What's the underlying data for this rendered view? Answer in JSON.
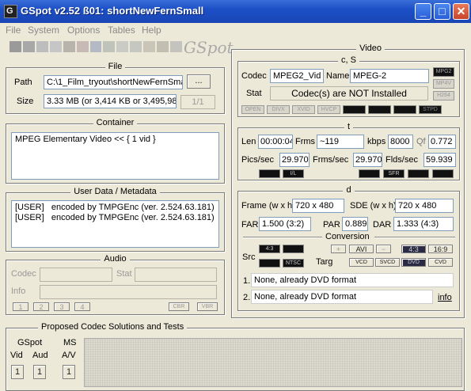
{
  "window": {
    "title": "GSpot v2.52 ß01: shortNewFernSmall",
    "minimize": "_",
    "maximize": "□",
    "close": "✕",
    "app_icon_glyph": "G"
  },
  "menu": [
    "File",
    "System",
    "Options",
    "Tables",
    "Help"
  ],
  "logo": "GSpot",
  "progress_colors": [
    "#9a9a9a",
    "#a8a8a8",
    "#bdbdbd",
    "#c6c6c6",
    "#b8b4ab",
    "#c7b9b5",
    "#b5b9c4",
    "#bfc3ba",
    "#cbcbc5",
    "#c5c8c0",
    "#c9c5b7",
    "#c2beb2",
    "#c5c3bd"
  ],
  "file": {
    "title": "File",
    "path_label": "Path",
    "path_value": "C:\\1_Film_tryout\\shortNewFernSma",
    "browse_label": "...",
    "size_label": "Size",
    "size_value": "3.33 MB (or 3,414 KB or 3,495,989 byt",
    "page_label": "1/1"
  },
  "container": {
    "title": "Container",
    "text": "MPEG Elementary Video << { 1 vid }"
  },
  "userdata": {
    "title": "User Data / Metadata",
    "lines": "[USER]   encoded by TMPGEnc (ver. 2.524.63.181)\n[USER]   encoded by TMPGEnc (ver. 2.524.63.181)"
  },
  "audio": {
    "title": "Audio",
    "codec_label": "Codec",
    "stat_label": "Stat",
    "info_label": "Info",
    "btn1": "1",
    "btn2": "2",
    "btn3": "3",
    "btn4": "4",
    "cbr": "CBR",
    "vbr": "VBR"
  },
  "proposed": {
    "title": "Proposed Codec Solutions and Tests",
    "gspot_label": "GSpot",
    "ms_label": "MS",
    "vid_label": "Vid",
    "aud_label": "Aud",
    "av_label": "A/V",
    "vid_btn": "1",
    "aud_btn": "1",
    "av_btn": "1"
  },
  "video": {
    "title": "Video",
    "cs": {
      "title": "c, S",
      "codec_label": "Codec",
      "codec_value": "MPEG2_Vid",
      "name_label": "Name",
      "name_value": "MPEG-2",
      "stat_label": "Stat",
      "stat_value": "Codec(s) are NOT Installed",
      "badge_mpg2": "MPG2",
      "badge_mp4": "MP4V",
      "badge_h264": "H264",
      "opts": [
        "OPEN",
        "DIVX",
        "XVID",
        "HVCP",
        "",
        "",
        "",
        "STPD"
      ]
    },
    "t": {
      "title": "t",
      "len_label": "Len",
      "len_value": "00:00:04",
      "frms_label": "Frms",
      "frms_value": "~119",
      "kbps_label": "kbps",
      "kbps_value": "8000",
      "qf_label": "Qf",
      "qf_value": "0.772",
      "pics_label": "Pics/sec",
      "pics_value": "29.970",
      "frms_sec_label": "Frms/sec",
      "frms_sec_value": "29.970",
      "flds_label": "Flds/sec",
      "flds_value": "59.939",
      "ixl": "I/L",
      "sfr": "SFR"
    },
    "d": {
      "title": "d",
      "frame_label": "Frame (w x h)",
      "frame_value": "720 x 480",
      "sde_label": "SDE (w x h)",
      "sde_value": "720 x 480",
      "far_label": "FAR",
      "far_value": "1.500 (3:2)",
      "par_label": "PAR",
      "par_value": "0.889",
      "dar_label": "DAR",
      "dar_value": "1.333 (4:3)"
    },
    "conversion": {
      "title": "Conversion",
      "src_label": "Src",
      "targ_label": "Targ",
      "src_43": "4:3",
      "src_ntsc": "NTSC",
      "plus": "+",
      "avi": "AVI",
      "minus": "−",
      "t43": "4:3",
      "t169": "16:9",
      "vcd": "VCD",
      "svcd": "SVCD",
      "dvd": "DVD",
      "cvd": "CVD",
      "line1_num": "1.",
      "line1": "None, already DVD format",
      "line2_num": "2.",
      "line2": "None, already DVD format",
      "info_link": "info"
    }
  }
}
